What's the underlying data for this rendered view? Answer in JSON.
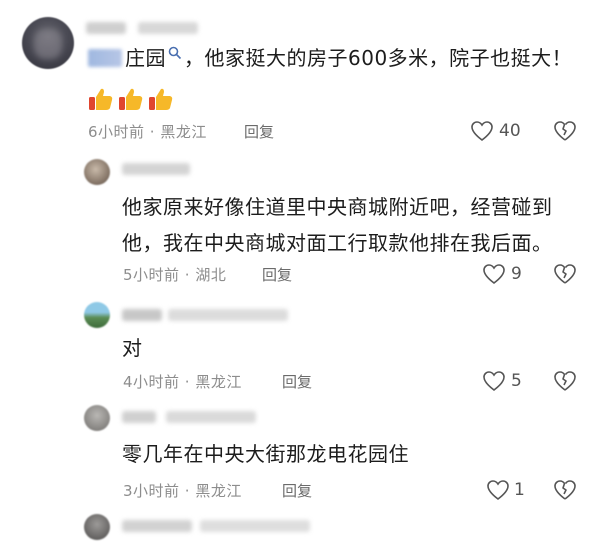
{
  "comments": [
    {
      "text_line1": "庄园",
      "text_rest": "，他家挺大的房子600多米，院子也挺大！",
      "emoji": [
        "thumbs-up-icon",
        "thumbs-up-icon",
        "thumbs-up-icon"
      ],
      "time": "6小时前 · 黑龙江",
      "reply_label": "回复",
      "likes": "40"
    },
    {
      "text_line1": "他家原来好像住道里中央商城附近吧，经营碰到",
      "text_line2": "他，我在中央商城对面工行取款他排在我后面。",
      "time": "5小时前 · 湖北",
      "reply_label": "回复",
      "likes": "9"
    },
    {
      "text_line1": "对",
      "time": "4小时前 · 黑龙江",
      "reply_label": "回复",
      "likes": "5"
    },
    {
      "text_line1": "零几年在中央大街那龙电花园住",
      "time": "3小时前 · 黑龙江",
      "reply_label": "回复",
      "likes": "1"
    }
  ],
  "colors": {
    "meta": "#8d8d8d",
    "text": "#1c1c1c",
    "icon": "#555555",
    "thumb_yellow": "#f6b829",
    "thumb_cuff": "#e0452f"
  }
}
